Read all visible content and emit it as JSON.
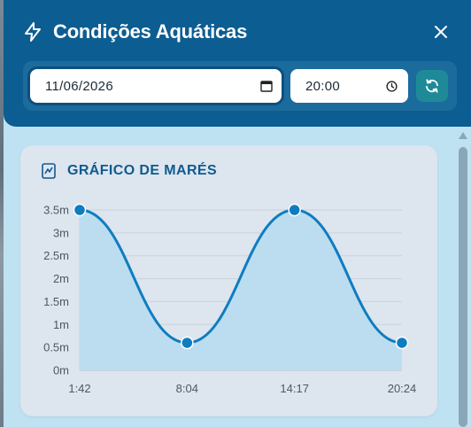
{
  "header": {
    "title": "Condições Aquáticas",
    "date_value": "11/06/2026",
    "time_value": "20:00",
    "icons": {
      "title": "lightning-bolt-icon",
      "close": "close-icon",
      "calendar": "calendar-icon",
      "clock": "clock-icon",
      "refresh": "refresh-icon"
    }
  },
  "card": {
    "title": "GRÁFICO DE MARÉS",
    "icon": "line-chart-icon"
  },
  "colors": {
    "header_bg": "#0c5d92",
    "accent_line": "#0e7dc0",
    "refresh_bg": "#1e8a98"
  },
  "chart_data": {
    "type": "area",
    "title": "",
    "xlabel": "",
    "ylabel": "",
    "x": [
      "1:42",
      "8:04",
      "14:17",
      "20:24"
    ],
    "values": [
      3.5,
      0.6,
      3.5,
      0.6
    ],
    "y_ticks": [
      "0m",
      "0.5m",
      "1m",
      "1.5m",
      "2m",
      "2.5m",
      "3m",
      "3.5m"
    ],
    "ylim": [
      0,
      3.5
    ],
    "grid": true,
    "smooth": true
  }
}
